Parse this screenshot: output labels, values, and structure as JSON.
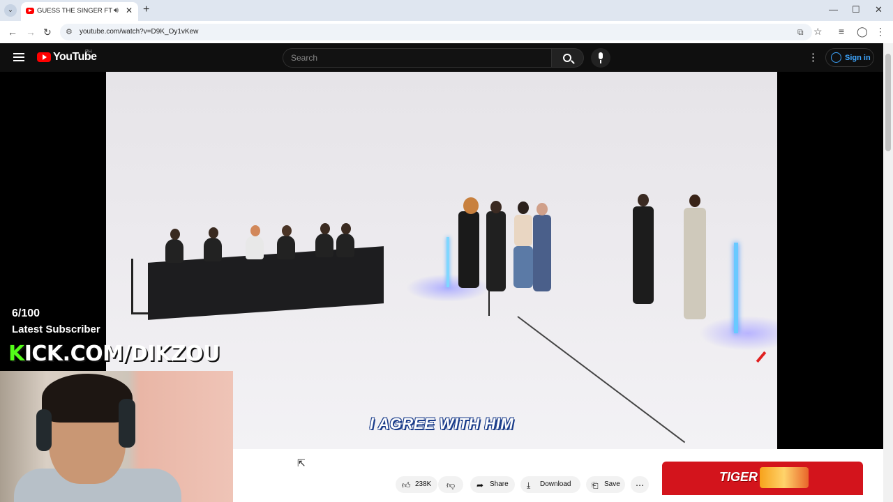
{
  "browser": {
    "tab_title": "GUESS THE SINGER FT ED S",
    "url": "youtube.com/watch?v=D9K_Oy1vKew",
    "icons": [
      "tab-dropdown-icon",
      "audio-icon",
      "close-icon",
      "new-tab-icon",
      "back-icon",
      "forward-icon",
      "reload-icon",
      "site-info-icon",
      "install-icon",
      "bookmark-star-icon",
      "extensions-icon",
      "profile-icon",
      "menu-icon",
      "minimize-icon",
      "maximize-icon",
      "window-close-icon"
    ]
  },
  "youtube": {
    "logo_text": "YouTube",
    "country_code": "PH",
    "search_placeholder": "Search",
    "signin_label": "Sign in"
  },
  "video": {
    "subtitle": "I AGREE WITH HIM"
  },
  "stream_overlay": {
    "count": "6/100",
    "latest_subscriber": "Latest Subscriber",
    "kick_k": "K",
    "kick_rest": "ICK.COM/DIKZOU"
  },
  "actions": {
    "likes": "238K",
    "share": "Share",
    "download": "Download",
    "save": "Save"
  },
  "ad": {
    "brand": "TIGER"
  },
  "colors": {
    "brand_red": "#ff0000",
    "kick_green": "#53fc18",
    "link_blue": "#3ea6ff"
  }
}
